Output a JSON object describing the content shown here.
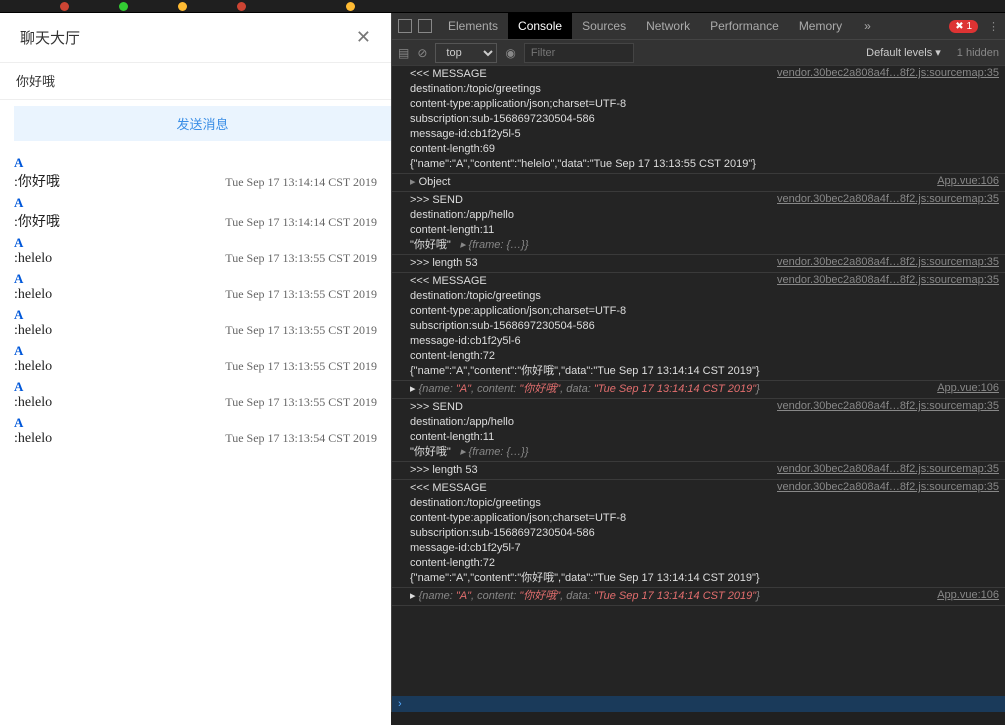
{
  "chat": {
    "title": "聊天大厅",
    "close": "✕",
    "input_value": "你好哦",
    "send_label": "发送消息",
    "messages": [
      {
        "user": "A",
        "content": ":你好哦",
        "ts": "Tue Sep 17 13:14:14 CST 2019"
      },
      {
        "user": "A",
        "content": ":你好哦",
        "ts": "Tue Sep 17 13:14:14 CST 2019"
      },
      {
        "user": "A",
        "content": ":helelo",
        "ts": "Tue Sep 17 13:13:55 CST 2019"
      },
      {
        "user": "A",
        "content": ":helelo",
        "ts": "Tue Sep 17 13:13:55 CST 2019"
      },
      {
        "user": "A",
        "content": ":helelo",
        "ts": "Tue Sep 17 13:13:55 CST 2019"
      },
      {
        "user": "A",
        "content": ":helelo",
        "ts": "Tue Sep 17 13:13:55 CST 2019"
      },
      {
        "user": "A",
        "content": ":helelo",
        "ts": "Tue Sep 17 13:13:55 CST 2019"
      },
      {
        "user": "A",
        "content": ":helelo",
        "ts": "Tue Sep 17 13:13:54 CST 2019"
      }
    ]
  },
  "devtools": {
    "tabs": [
      "Elements",
      "Console",
      "Sources",
      "Network",
      "Performance",
      "Memory"
    ],
    "active_tab": "Console",
    "error_count": "1",
    "more": "»",
    "context": "top",
    "filter_placeholder": "Filter",
    "levels": "Default levels ▾",
    "hidden": "1 hidden",
    "src_vendor": "vendor.30bec2a808a4f…8f2.js:sourcemap:35",
    "src_app": "App.vue:106",
    "groups": [
      {
        "type": "msg",
        "src": "vendor",
        "lines": [
          "<<< MESSAGE",
          "destination:/topic/greetings",
          "content-type:application/json;charset=UTF-8",
          "subscription:sub-1568697230504-586",
          "message-id:cb1f2y5l-5",
          "content-length:69",
          "",
          "{\"name\":\"A\",\"content\":\"helelo\",\"data\":\"Tue Sep 17 13:13:55 CST 2019\"}"
        ]
      },
      {
        "type": "obj",
        "src": "app",
        "text": "Object"
      },
      {
        "type": "msg",
        "src": "vendor",
        "lines": [
          ">>> SEND",
          "destination:/app/hello",
          "content-length:11",
          "",
          "\"你好哦\"   ▸ {frame: {…}}"
        ]
      },
      {
        "type": "msg",
        "src": "vendor",
        "lines": [
          ">>> length 53"
        ]
      },
      {
        "type": "msg",
        "src": "vendor",
        "lines": [
          "<<< MESSAGE",
          "destination:/topic/greetings",
          "content-type:application/json;charset=UTF-8",
          "subscription:sub-1568697230504-586",
          "message-id:cb1f2y5l-6",
          "content-length:72",
          "",
          "{\"name\":\"A\",\"content\":\"你好哦\",\"data\":\"Tue Sep 17 13:14:14 CST 2019\"}"
        ]
      },
      {
        "type": "objred",
        "src": "app",
        "text": "{name: \"A\", content: \"你好哦\", data: \"Tue Sep 17 13:14:14 CST 2019\"}"
      },
      {
        "type": "msg",
        "src": "vendor",
        "lines": [
          ">>> SEND",
          "destination:/app/hello",
          "content-length:11",
          "",
          "\"你好哦\"   ▸ {frame: {…}}"
        ]
      },
      {
        "type": "msg",
        "src": "vendor",
        "lines": [
          ">>> length 53"
        ]
      },
      {
        "type": "msg",
        "src": "vendor",
        "lines": [
          "<<< MESSAGE",
          "destination:/topic/greetings",
          "content-type:application/json;charset=UTF-8",
          "subscription:sub-1568697230504-586",
          "message-id:cb1f2y5l-7",
          "content-length:72",
          "",
          "{\"name\":\"A\",\"content\":\"你好哦\",\"data\":\"Tue Sep 17 13:14:14 CST 2019\"}"
        ]
      },
      {
        "type": "objred",
        "src": "app",
        "text": "{name: \"A\", content: \"你好哦\", data: \"Tue Sep 17 13:14:14 CST 2019\"}"
      }
    ],
    "prompt": "›"
  }
}
